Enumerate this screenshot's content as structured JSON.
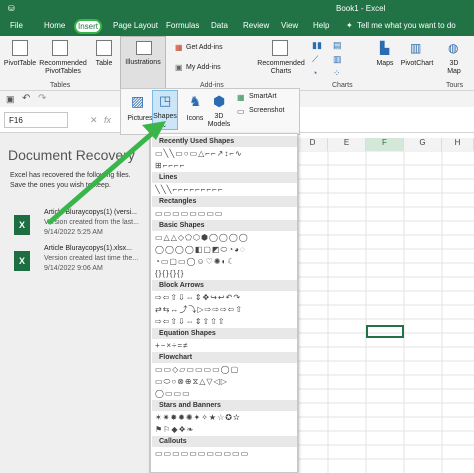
{
  "titlebar": {
    "doc": "Book1",
    "sep": " - ",
    "app": "Excel"
  },
  "tabs": [
    "File",
    "Home",
    "Insert",
    "Page Layout",
    "Formulas",
    "Data",
    "Review",
    "View",
    "Help"
  ],
  "search": {
    "icon": "lightbulb-icon",
    "text": "Tell me what you want to do"
  },
  "ribbon": {
    "pivottable": "PivotTable",
    "recommended_pivot": [
      "Recommended",
      "PivotTables"
    ],
    "table": "Table",
    "tables_group": "Tables",
    "illustrations": "Illustrations",
    "get_addins": "Get Add-ins",
    "my_addins": "My Add-ins",
    "addins_group": "Add-ins",
    "recommended_charts": [
      "Recommended",
      "Charts"
    ],
    "charts_group": "Charts",
    "maps": "Maps",
    "pivotchart": "PivotChart",
    "map3d": [
      "3D",
      "Map"
    ],
    "tours_group": "Tours"
  },
  "dropdown": {
    "pictures": "Pictures",
    "shapes": "Shapes",
    "icons": "Icons",
    "models": [
      "3D",
      "Models"
    ],
    "smartart": "SmartArt",
    "screenshot": "Screenshot"
  },
  "formula": {
    "namebox": "F16",
    "fx": "fx"
  },
  "recovery": {
    "title": "Document Recovery",
    "desc": "Excel has recovered the following files.  Save the ones you wish to keep.",
    "files": [
      {
        "name": "Article Bluraycopys(1) (versi...",
        "sub": "Version created from the last...",
        "date": "9/14/2022 5:25 AM"
      },
      {
        "name": "Article Bluraycopys(1).xlsx...",
        "sub": "Version created last time the...",
        "date": "9/14/2022 9:06 AM"
      }
    ]
  },
  "columns": [
    "D",
    "E",
    "F",
    "G",
    "H"
  ],
  "shapes": {
    "sections": [
      "Recently Used Shapes",
      "Lines",
      "Rectangles",
      "Basic Shapes",
      "Block Arrows",
      "Equation Shapes",
      "Flowchart",
      "Stars and Banners",
      "Callouts"
    ],
    "rows": [
      "▭╲╲▭○▭△⌐⌐↗↕⌐∿",
      "⊞⌐⌐⌐⌐",
      "╲╲╲⌐⌐⌐⌐⌐⌐⌐⌐⌐",
      "▭▭▭▭▭▭▭▭",
      "▭△△◇⬠⬡⬢◯◯◯◯",
      "◯◯◯◯◧▢◩⬭◔◕◌",
      "◔▭▢▭◯☺♡✺◐☾",
      "{}{}{}{}",
      "⇨⇦⇧⇩⇔⇕✥↪↩↶↷",
      "⇄⇆↔⤴⤵▷⇨⇨⇨⇦⇧",
      "⇨⇦⇧⇩⇔⇕⇧⇧⇧",
      "+−×÷=≠",
      "▭▭◇▱▭▭▭▭◯▢",
      "▭⬭○⊗⊕⧖△▽◁▷",
      "◯▭▭▭",
      "✶✷✸✹✺✦✧★☆✪✫",
      "⚑⚐◆❖❧",
      "▭▭▭▭▭▭▭▭▭▭▭"
    ]
  }
}
